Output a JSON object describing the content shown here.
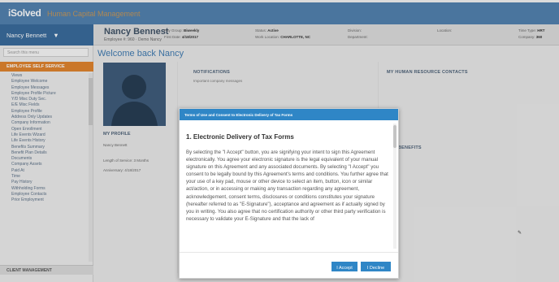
{
  "brand": {
    "logo": "iSolved",
    "subtitle": "Human Capital Management"
  },
  "user_menu": {
    "label": "Nancy Bennett",
    "pin_icon": "pin-icon"
  },
  "employee": {
    "name": "Nancy Bennest",
    "sub": "Employee #: 960 · Demo Nancy",
    "fields": [
      {
        "label": "Pay Group:",
        "value": "Biweekly"
      },
      {
        "label": "First Date:",
        "value": "4/18/2017"
      },
      {
        "label": "Status:",
        "value": "Active"
      },
      {
        "label": "Work Location:",
        "value": "CHARLOTTE, NC"
      },
      {
        "label": "Division:",
        "value": ""
      },
      {
        "label": "Department:",
        "value": ""
      },
      {
        "label": "Location:",
        "value": ""
      },
      {
        "label": "Time Type:",
        "value": "HRT"
      },
      {
        "label": "Company:",
        "value": "360"
      }
    ]
  },
  "sidebar": {
    "search_placeholder": "Search this menu",
    "section": "EMPLOYEE SELF SERVICE",
    "items": [
      "Views",
      "Employee Welcome",
      "Employee Messages",
      "Employee Profile Picture",
      "Y/D Misc Duty Sec.",
      "E/E Misc Fields",
      "Employee Profile",
      "Address Only Updates",
      "Company Information",
      "Open Enrollment",
      "Life Events Wizard",
      "Life Events History",
      "Benefits Summary",
      "Benefit Plan Details",
      "Documents",
      "Company Assets",
      "Paid At",
      "Time",
      "Pay History",
      "Withholding Forms",
      "Employee Contacts",
      "Prior Employment"
    ],
    "client_section": "CLIENT MANAGEMENT"
  },
  "main": {
    "welcome": "Welcome back Nancy",
    "notifications_title": "NOTIFICATIONS",
    "notifications_sub": "Important company messages",
    "hr_contacts_title": "MY HUMAN RESOURCE CONTACTS",
    "benefits_title": "BENEFITS",
    "profile_title": "MY PROFILE",
    "profile_name": "Nancy Bennett",
    "length_of_service": "Length of Service: 3 Months",
    "anniversary": "Anniversary: 4/18/2017"
  },
  "modal": {
    "header": "Terms of Use and Consent to Electronic Delivery of Tax Forms",
    "heading": "1. Electronic Delivery of Tax Forms",
    "body": "By selecting the \"I Accept\" button, you are signifying your intent to sign this Agreement electronically. You agree your electronic signature is the legal equivalent of your manual signature on this Agreement and any associated documents. By selecting \"I Accept\" you consent to be legally bound by this Agreement's terms and conditions. You further agree that your use of a key pad, mouse or other device to select an item, button, icon or similar act/action, or in accessing or making any transaction regarding any agreement, acknowledgement, consent terms, disclosures or conditions constitutes your signature (hereafter referred to as \"E-Signature\"), acceptance and agreement as if actually signed by you in writing. You also agree that no certification authority or other third party verification is necessary to validate your E-Signature and that the lack of",
    "accept_label": "I Accept",
    "decline_label": "I Decline"
  }
}
